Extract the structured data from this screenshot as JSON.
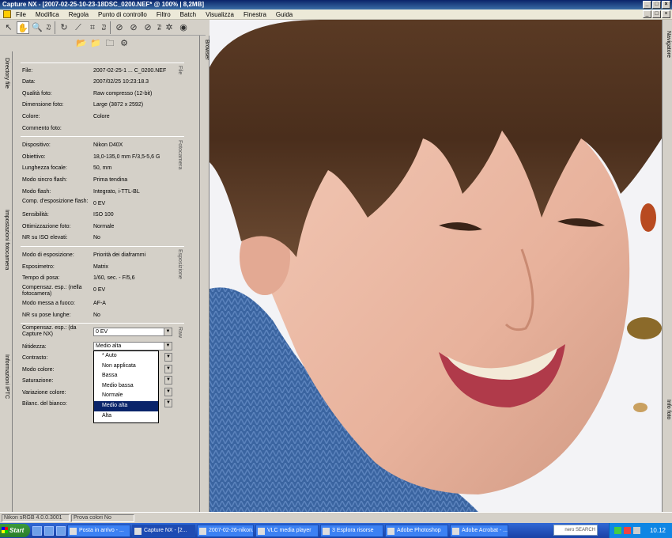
{
  "window": {
    "title": "Capture NX - [2007-02-25-10-23-18DSC_0200.NEF* @ 100% | 8,2MB]",
    "controls": [
      "_",
      "□",
      "×"
    ]
  },
  "menu": {
    "items": [
      "File",
      "Modifica",
      "Regola",
      "Punto di controllo",
      "Filtro",
      "Batch",
      "Visualizza",
      "Finestra",
      "Guida"
    ]
  },
  "toolbar": {
    "labels": [
      "F2",
      "F3",
      "F4",
      "F5"
    ]
  },
  "left_tabs": {
    "directory": "Directory file",
    "camera_settings": "Impostazioni fotocamera",
    "iptc": "Informazioni IPTC"
  },
  "browser_tab": "Browser",
  "right_tabs": {
    "navigator": "Navigatore",
    "photo_info": "Info foto"
  },
  "file_section": {
    "label": "File",
    "rows": [
      {
        "label": "File:",
        "value": "2007-02-25-1 ... C_0200.NEF"
      },
      {
        "label": "Data:",
        "value": "2007/02/25 10:23:18.3"
      },
      {
        "label": "Qualità foto:",
        "value": "Raw compresso (12-bit)"
      },
      {
        "label": "Dimensione foto:",
        "value": "Large (3872 x 2592)"
      },
      {
        "label": "Colore:",
        "value": "Colore"
      },
      {
        "label": "Commento foto:",
        "value": ""
      }
    ]
  },
  "camera_section": {
    "label": "Fotocamera",
    "rows": [
      {
        "label": "Dispositivo:",
        "value": "Nikon D40X"
      },
      {
        "label": "Obiettivo:",
        "value": "18,0-135,0 mm F/3,5-5,6 G"
      },
      {
        "label": "Lunghezza focale:",
        "value": "50, mm"
      },
      {
        "label": "Modo sincro flash:",
        "value": "Prima tendina"
      },
      {
        "label": "Modo flash:",
        "value": "Integrato, i-TTL-BL"
      },
      {
        "label": "Comp. d'esposizione flash:",
        "value": "0 EV"
      },
      {
        "label": "Sensibilità:",
        "value": "ISO 100"
      },
      {
        "label": "Ottimizzazione foto:",
        "value": "Normale"
      },
      {
        "label": "NR su ISO elevati:",
        "value": "No"
      }
    ]
  },
  "exposure_section": {
    "label": "Esposizione",
    "rows": [
      {
        "label": "Modo di esposizione:",
        "value": "Priorità dei diaframmi"
      },
      {
        "label": "Esposimetro:",
        "value": "Matrix"
      },
      {
        "label": "Tempo di posa:",
        "value": "1/60, sec. - F/5,6"
      },
      {
        "label": "Compensaz. esp.: (nella fotocamera)",
        "value": "0 EV"
      },
      {
        "label": "Modo messa a fuoco:",
        "value": "AF-A"
      },
      {
        "label": "NR su pose lunghe:",
        "value": "No"
      }
    ]
  },
  "raw_section": {
    "label": "Raw",
    "exp_comp_label": "Compensaz. esp.: (da Capture NX)",
    "exp_comp_value": "0 EV",
    "sharpness_label": "Nitidezza:",
    "sharpness_value": "Medio alta",
    "contrast_label": "Contrasto:",
    "color_mode_label": "Modo colore:",
    "saturation_label": "Saturazione:",
    "hue_label": "Variazione colore:",
    "wb_label": "Bilanc. del bianco:"
  },
  "dropdown": {
    "options": [
      "* Auto",
      "Non applicata",
      "Bassa",
      "Medio bassa",
      "Normale",
      "Medio alta",
      "Alta"
    ],
    "selected": "Medio alta"
  },
  "statusbar": {
    "profile": "Nikon sRGB 4.0.0.3001",
    "proof": "Prova colori No"
  },
  "taskbar": {
    "start": "Start",
    "tasks": [
      "Posta in arrivo - ...",
      "Capture NX - [2...",
      "2007-02-26-nikon...",
      "VLC media player",
      "3 Esplora risorse",
      "Adobe Photoshop",
      "Adobe Acrobat - ..."
    ],
    "search": "nero SEARCH",
    "clock": "10.12"
  },
  "colors": {
    "title_start": "#0a246a",
    "selection": "#0a246a",
    "taskbar": "#245edb",
    "sweater": "#3a64a0"
  }
}
